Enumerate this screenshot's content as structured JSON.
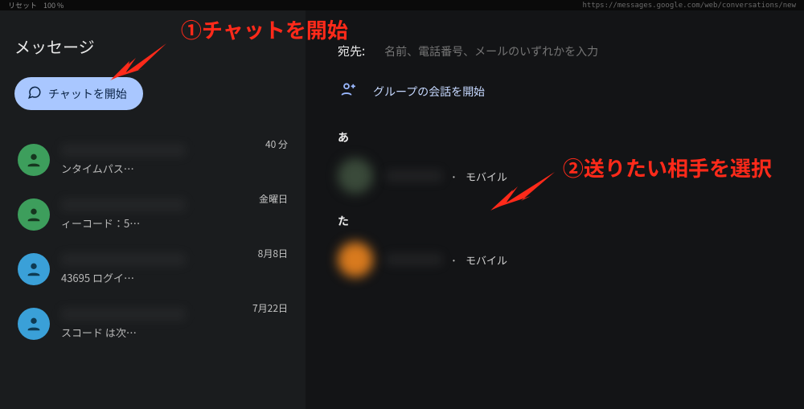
{
  "topbar": {
    "zoom": "100 %",
    "reset": "リセット",
    "url": "https://messages.google.com/web/conversations/new"
  },
  "sidebar": {
    "title": "メッセージ",
    "start_chat_label": "チャットを開始",
    "conversations": [
      {
        "preview_suffix": "ンタイムパス…",
        "time": "40 分",
        "avatar_color": "#3d9e5c"
      },
      {
        "preview_suffix": "ィーコード：5…",
        "time": "金曜日",
        "avatar_color": "#3d9e5c"
      },
      {
        "preview_suffix": "43695 ログイ…",
        "time": "8月8日",
        "avatar_color": "#3aa0d8"
      },
      {
        "preview_suffix": "スコード は次…",
        "time": "7月22日",
        "avatar_color": "#3aa0d8"
      }
    ]
  },
  "main": {
    "to_label": "宛先:",
    "to_placeholder": "名前、電話番号、メールのいずれかを入力",
    "group_label": "グループの会話を開始",
    "sections": [
      {
        "label": "あ",
        "contacts": [
          {
            "type": "モバイル",
            "avatar_color": "#3a4a3a"
          }
        ]
      },
      {
        "label": "た",
        "contacts": [
          {
            "type": "モバイル",
            "avatar_color": "#d87a1e"
          }
        ]
      }
    ]
  },
  "annotations": {
    "step1": "①チャットを開始",
    "step2": "②送りたい相手を選択"
  },
  "colors": {
    "accent_button": "#a9c7ff",
    "annotation_red": "#ff2a1a"
  }
}
